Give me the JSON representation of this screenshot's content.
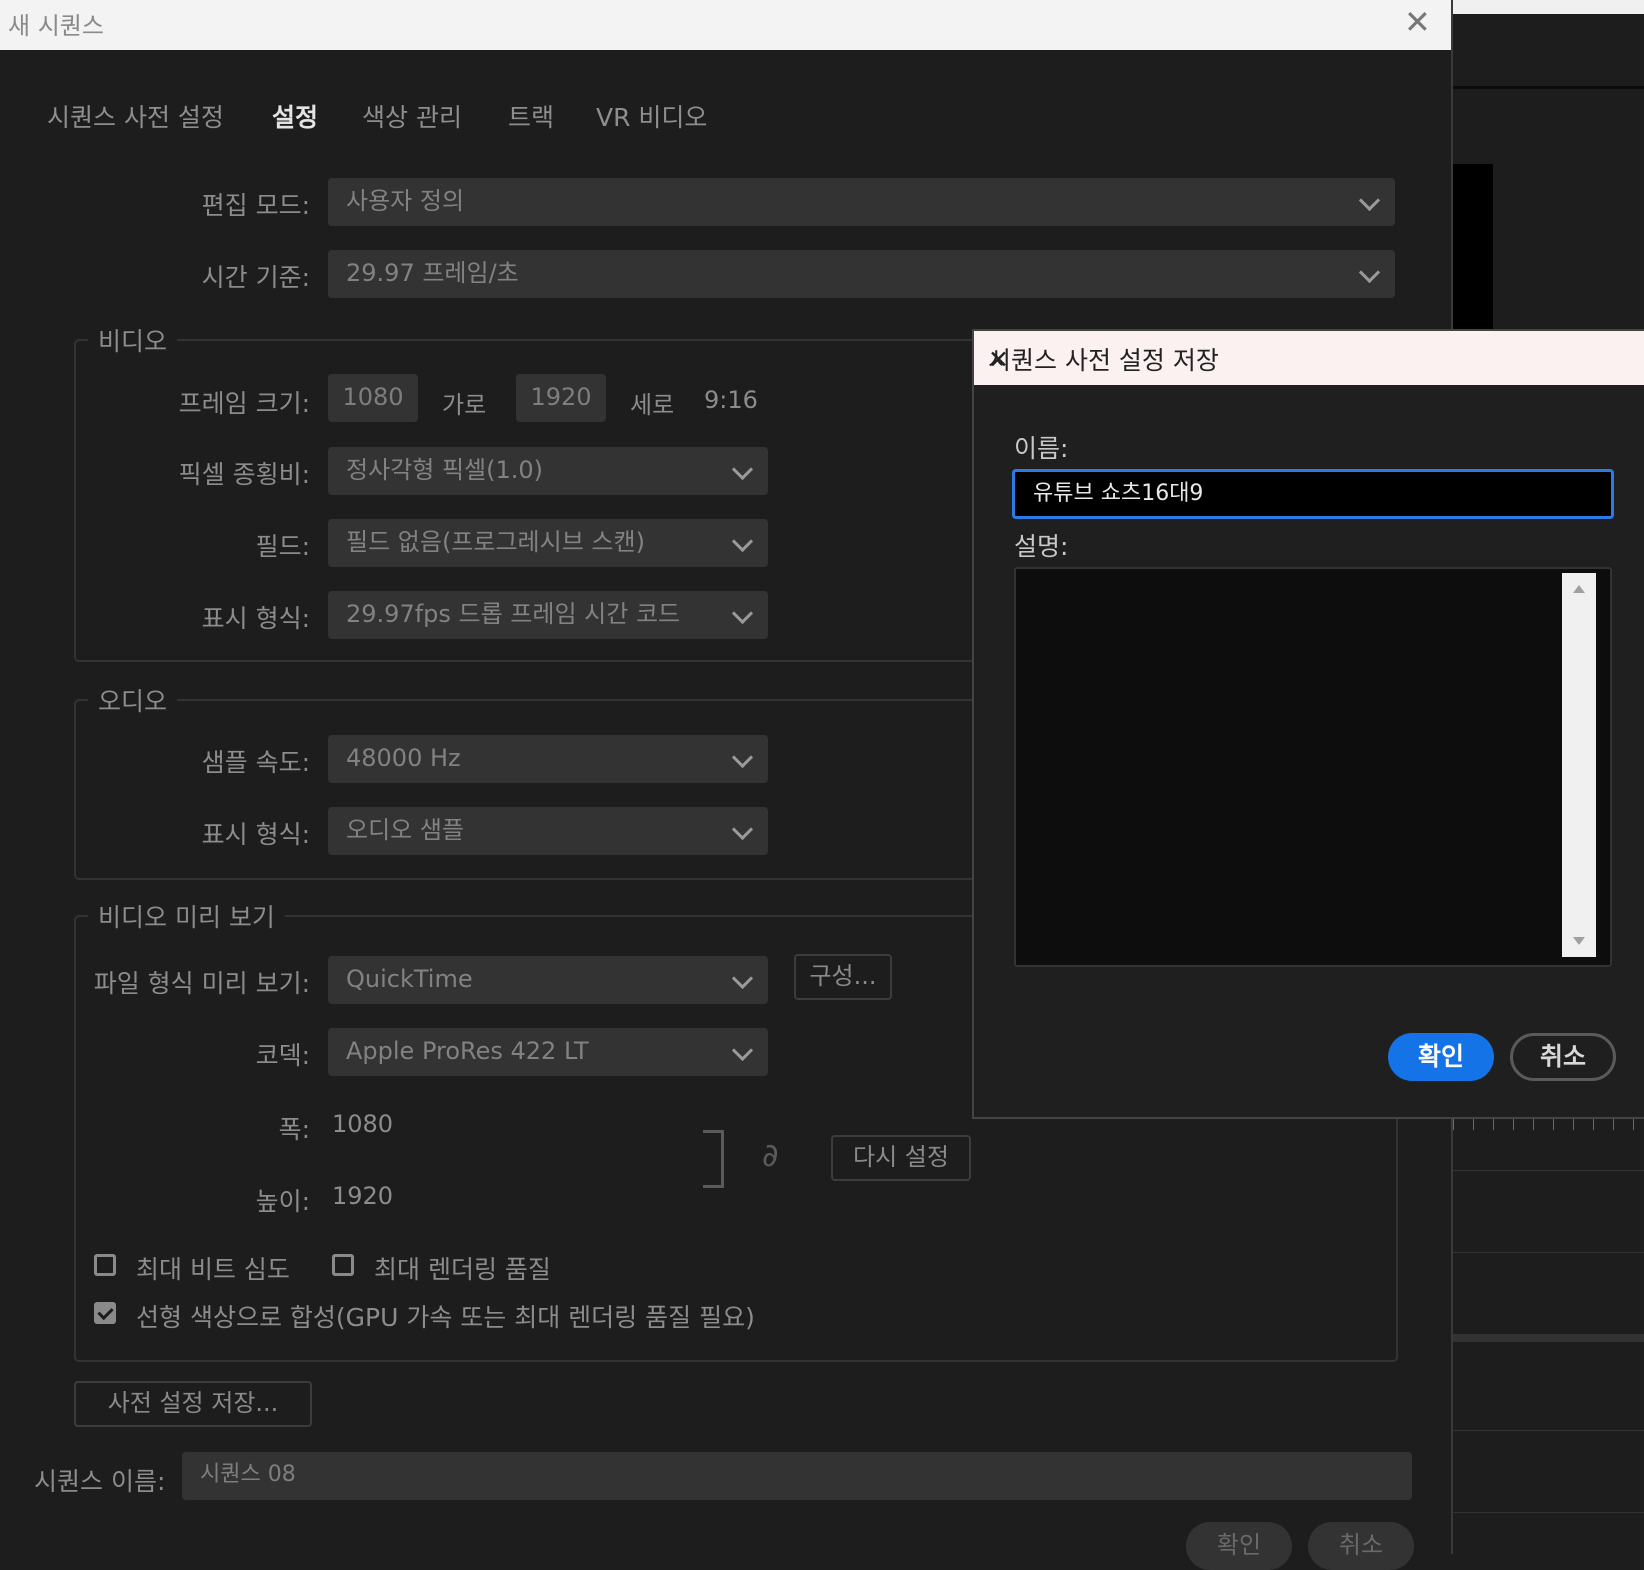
{
  "window": {
    "title": "새 시퀀스",
    "close_glyph": "✕"
  },
  "tabs": [
    "시퀀스 사전 설정",
    "설정",
    "색상 관리",
    "트랙",
    "VR 비디오"
  ],
  "active_tab": "설정",
  "general": {
    "edit_mode_label": "편집 모드:",
    "edit_mode_value": "사용자 정의",
    "timebase_label": "시간 기준:",
    "timebase_value": "29.97  프레임/초"
  },
  "video": {
    "group_label": "비디오",
    "frame_size_label": "프레임 크기:",
    "frame_width": "1080",
    "horizontal_label": "가로",
    "frame_height": "1920",
    "vertical_label": "세로",
    "aspect": "9:16",
    "pixel_aspect_label": "픽셀 종횡비:",
    "pixel_aspect_value": "정사각형 픽셀(1.0)",
    "fields_label": "필드:",
    "fields_value": "필드 없음(프로그레시브 스캔)",
    "display_format_label": "표시 형식:",
    "display_format_value": "29.97fps 드롭 프레임 시간 코드"
  },
  "audio": {
    "group_label": "오디오",
    "sample_rate_label": "샘플 속도:",
    "sample_rate_value": "48000 Hz",
    "display_format_label": "표시 형식:",
    "display_format_value": "오디오 샘플"
  },
  "preview": {
    "group_label": "비디오 미리 보기",
    "file_format_label": "파일 형식 미리 보기:",
    "file_format_value": "QuickTime",
    "configure_button": "구성...",
    "codec_label": "코덱:",
    "codec_value": "Apple ProRes 422 LT",
    "width_label": "폭:",
    "width_value": "1080",
    "height_label": "높이:",
    "height_value": "1920",
    "reset_button": "다시 설정",
    "link_glyph": "∂"
  },
  "options": {
    "max_bit_depth": {
      "label": "최대 비트 심도",
      "checked": false
    },
    "max_render_quality": {
      "label": "최대 렌더링 품질",
      "checked": false
    },
    "linear_color": {
      "label": "선형 색상으로 합성(GPU 가속 또는 최대 렌더링 품질 필요)",
      "checked": true
    }
  },
  "save_preset_button": "사전 설정 저장...",
  "sequence_name_label": "시퀀스 이름:",
  "sequence_name_value": "시퀀스 08",
  "footer": {
    "ok_button": "확인",
    "cancel_button": "취소"
  },
  "save_dialog": {
    "title": "시퀀스 사전 설정 저장",
    "close_glyph": "✕",
    "name_label": "이름:",
    "name_value": "유튜브 쇼츠16대9",
    "description_label": "설명:",
    "description_value": "",
    "ok_button": "확인",
    "cancel_button": "취소",
    "accent_color": "#1473e6"
  }
}
